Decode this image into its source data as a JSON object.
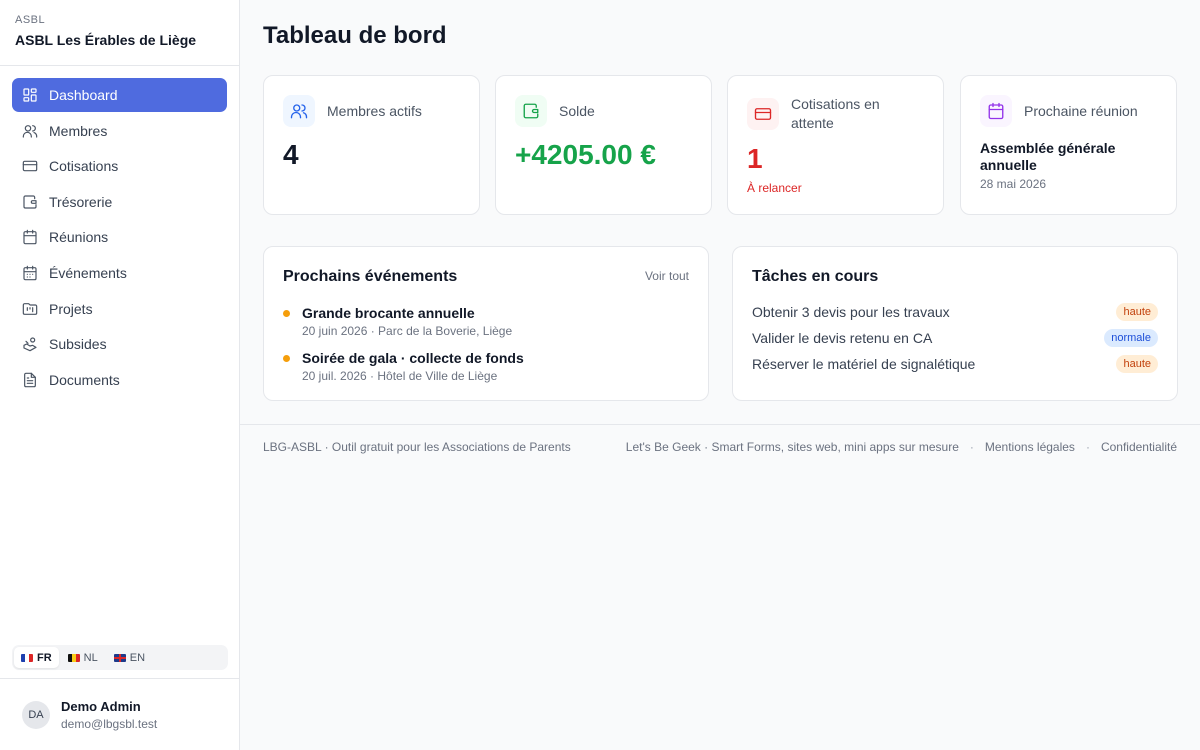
{
  "org": {
    "kicker": "ASBL",
    "name": "ASBL Les Érables de Liège"
  },
  "nav": [
    {
      "label": "Dashboard",
      "icon": "grid-icon",
      "active": true
    },
    {
      "label": "Membres",
      "icon": "users-icon"
    },
    {
      "label": "Cotisations",
      "icon": "credit-card-icon"
    },
    {
      "label": "Trésorerie",
      "icon": "wallet-icon"
    },
    {
      "label": "Réunions",
      "icon": "calendar-icon"
    },
    {
      "label": "Événements",
      "icon": "calendar-days-icon"
    },
    {
      "label": "Projets",
      "icon": "folder-icon"
    },
    {
      "label": "Subsides",
      "icon": "hand-coins-icon"
    },
    {
      "label": "Documents",
      "icon": "file-text-icon"
    }
  ],
  "languages": [
    {
      "code": "FR",
      "active": true
    },
    {
      "code": "NL",
      "active": false
    },
    {
      "code": "EN",
      "active": false
    }
  ],
  "user": {
    "initials": "DA",
    "name": "Demo Admin",
    "email": "demo@lbgsbl.test"
  },
  "page": {
    "title": "Tableau de bord"
  },
  "stats": {
    "members": {
      "label": "Membres actifs",
      "value": "4",
      "icon": "users-icon",
      "color": "#2563eb"
    },
    "balance": {
      "label": "Solde",
      "value": "+4205.00 €",
      "icon": "wallet-icon",
      "color": "#16a34a"
    },
    "dues": {
      "label": "Cotisations en attente",
      "value": "1",
      "sub": "À relancer",
      "icon": "credit-card-icon",
      "color": "#dc2626"
    },
    "meeting": {
      "label": "Prochaine réunion",
      "title": "Assemblée générale annuelle",
      "date": "28 mai 2026",
      "icon": "calendar-icon",
      "color": "#9333ea"
    }
  },
  "events": {
    "title": "Prochains événements",
    "link": "Voir tout",
    "items": [
      {
        "title": "Grande brocante annuelle",
        "meta": "20 juin 2026 · Parc de la Boverie, Liège"
      },
      {
        "title": "Soirée de gala · collecte de fonds",
        "meta": "20 juil. 2026 · Hôtel de Ville de Liège"
      }
    ]
  },
  "tasks": {
    "title": "Tâches en cours",
    "items": [
      {
        "text": "Obtenir 3 devis pour les travaux",
        "priority": "haute"
      },
      {
        "text": "Valider le devis retenu en CA",
        "priority": "normale"
      },
      {
        "text": "Réserver le matériel de signalétique",
        "priority": "haute"
      }
    ]
  },
  "footer": {
    "left": "LBG-ASBL · Outil gratuit pour les Associations de Parents",
    "links": [
      "Let's Be Geek · Smart Forms, sites web, mini apps sur mesure",
      "Mentions légales",
      "Confidentialité"
    ],
    "separator": "·"
  }
}
